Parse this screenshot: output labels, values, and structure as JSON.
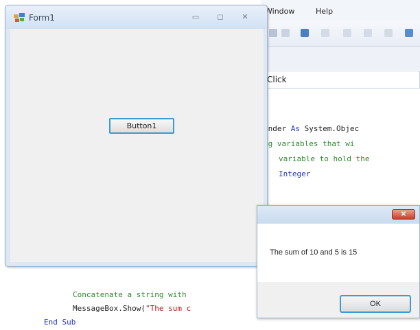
{
  "ide": {
    "menu": {
      "window": "Window",
      "help": "Help"
    },
    "dropdown_value": "Click",
    "code_lines": {
      "line1a": "ender ",
      "line1b": "As",
      "line1c": " System.Objec",
      "line2": "ng variables that wi",
      "line3": "variable to hold the",
      "line4": "Integer",
      "line5": "Concatenate a string with",
      "line6a": "MessageBox.Show(",
      "line6b": "\"The sum c",
      "line7": "End Sub"
    }
  },
  "form": {
    "title": "Form1",
    "minimize_glyph": "▭",
    "maximize_glyph": "◻",
    "close_glyph": "✕",
    "button_label": "Button1"
  },
  "message_box": {
    "text": "The sum of 10 and 5 is 15",
    "ok_label": "OK",
    "close_glyph": "✕"
  },
  "colors": {
    "keyword": "#2436b8",
    "comment": "#2f8a2f",
    "string": "#b01a1a",
    "focus_border": "#3d9bd3"
  }
}
